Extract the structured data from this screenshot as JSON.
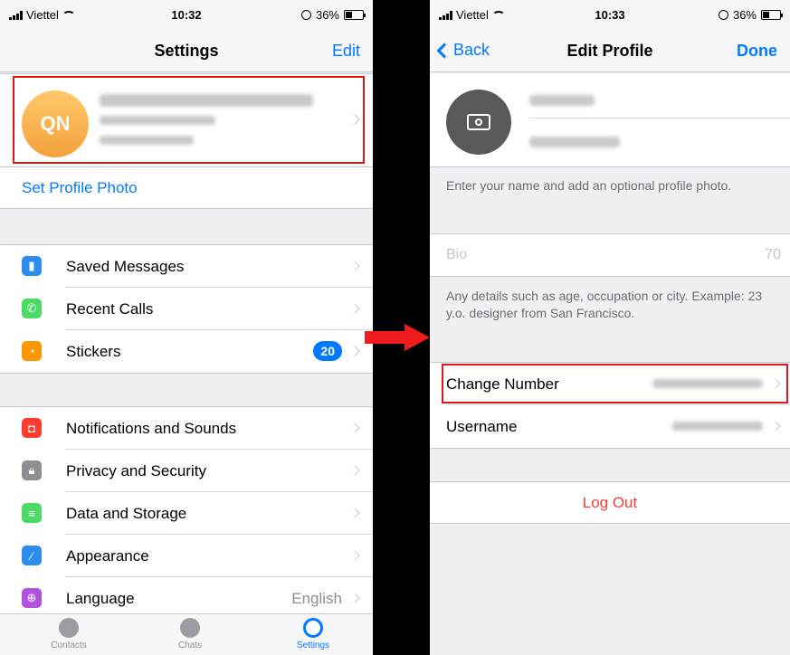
{
  "left": {
    "status": {
      "carrier": "Viettel",
      "time": "10:32",
      "battery": "36%"
    },
    "nav": {
      "title": "Settings",
      "edit": "Edit"
    },
    "profile": {
      "initials": "QN"
    },
    "set_photo": "Set Profile Photo",
    "group1": [
      {
        "label": "Saved Messages",
        "icon": "bookmark-icon",
        "color": "#2d8cf0"
      },
      {
        "label": "Recent Calls",
        "icon": "phone-icon",
        "color": "#4cd964"
      },
      {
        "label": "Stickers",
        "icon": "sticker-icon",
        "color": "#ff9500",
        "badge": "20"
      }
    ],
    "group2": [
      {
        "label": "Notifications and Sounds",
        "icon": "bell-icon",
        "color": "#ff3b30"
      },
      {
        "label": "Privacy and Security",
        "icon": "lock-icon",
        "color": "#8e8e93"
      },
      {
        "label": "Data and Storage",
        "icon": "database-icon",
        "color": "#4cd964"
      },
      {
        "label": "Appearance",
        "icon": "brush-icon",
        "color": "#2d8cf0"
      },
      {
        "label": "Language",
        "icon": "globe-icon",
        "color": "#af52de",
        "value": "English"
      }
    ],
    "tabs": [
      {
        "label": "Contacts",
        "icon": "contacts-icon"
      },
      {
        "label": "Chats",
        "icon": "chats-icon"
      },
      {
        "label": "Settings",
        "icon": "settings-icon",
        "active": true
      }
    ]
  },
  "right": {
    "status": {
      "carrier": "Viettel",
      "time": "10:33",
      "battery": "36%"
    },
    "nav": {
      "back": "Back",
      "title": "Edit Profile",
      "done": "Done"
    },
    "name_note": "Enter your name and add an optional profile photo.",
    "bio": {
      "placeholder": "Bio",
      "count": "70"
    },
    "bio_note": "Any details such as age, occupation or city. Example: 23 y.o. designer from San Francisco.",
    "change_number": "Change Number",
    "username": "Username",
    "logout": "Log Out"
  },
  "colors": {
    "accent": "#007aff",
    "highlight": "#e0161b",
    "destructive": "#ff3b30",
    "arrow": "#ee1c1c"
  }
}
